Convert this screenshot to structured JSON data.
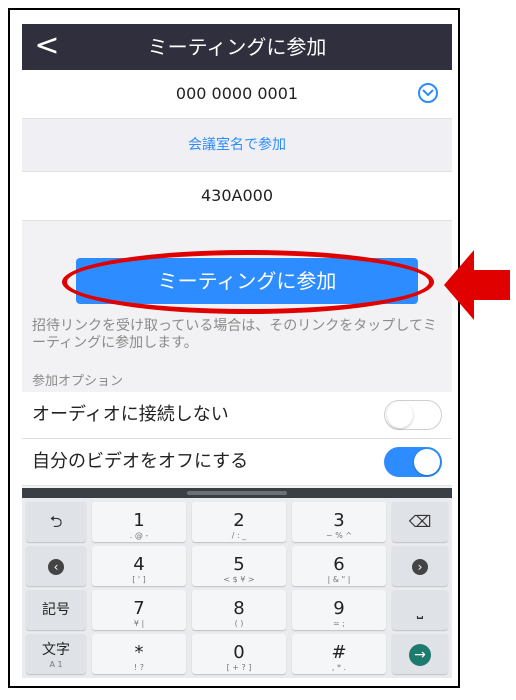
{
  "header": {
    "back_glyph": "<",
    "title": "ミーティングに参加"
  },
  "meeting_id": {
    "value": "000 0000 0001",
    "dropdown_icon": "chevron-down-circle-icon"
  },
  "join_with_room": {
    "label": "会議室名で参加"
  },
  "display_name": {
    "value": "430A000"
  },
  "join_button": {
    "label": "ミーティングに参加"
  },
  "hint_text": "招待リンクを受け取っている場合は、そのリンクをタップしてミーティングに参加します。",
  "options": {
    "section_label": "参加オプション",
    "items": [
      {
        "label": "オーディオに接続しない",
        "state": "off"
      },
      {
        "label": "自分のビデオをオフにする",
        "state": "on"
      }
    ]
  },
  "keyboard": {
    "digits": [
      {
        "main": "1",
        "sub": ". @ -"
      },
      {
        "main": "2",
        "sub": "/ : _"
      },
      {
        "main": "3",
        "sub": "~ % ^"
      },
      {
        "main": "4",
        "sub": "[ ' ]"
      },
      {
        "main": "5",
        "sub": "< $ ¥ >"
      },
      {
        "main": "6",
        "sub": "| & \" |"
      },
      {
        "main": "7",
        "sub": "¥ |"
      },
      {
        "main": "8",
        "sub": "( )"
      },
      {
        "main": "9",
        "sub": "= ;"
      },
      {
        "main": "*",
        "sub": "! ?"
      },
      {
        "main": "0",
        "sub": "[ + ? ]"
      },
      {
        "main": "#",
        "sub": ", * ."
      }
    ],
    "left_keys": {
      "undo_icon": "undo-icon",
      "left_icon": "left-arrow-icon",
      "symbols": "記号",
      "kana": "文字",
      "kana_sub": "A 1"
    },
    "right_keys": {
      "backspace_icon": "backspace-icon",
      "right_icon": "right-arrow-icon",
      "space_icon": "space-icon",
      "enter_icon": "enter-icon"
    }
  },
  "annotation": {
    "highlight_color": "#e00000",
    "accent": "#2d8cff"
  }
}
